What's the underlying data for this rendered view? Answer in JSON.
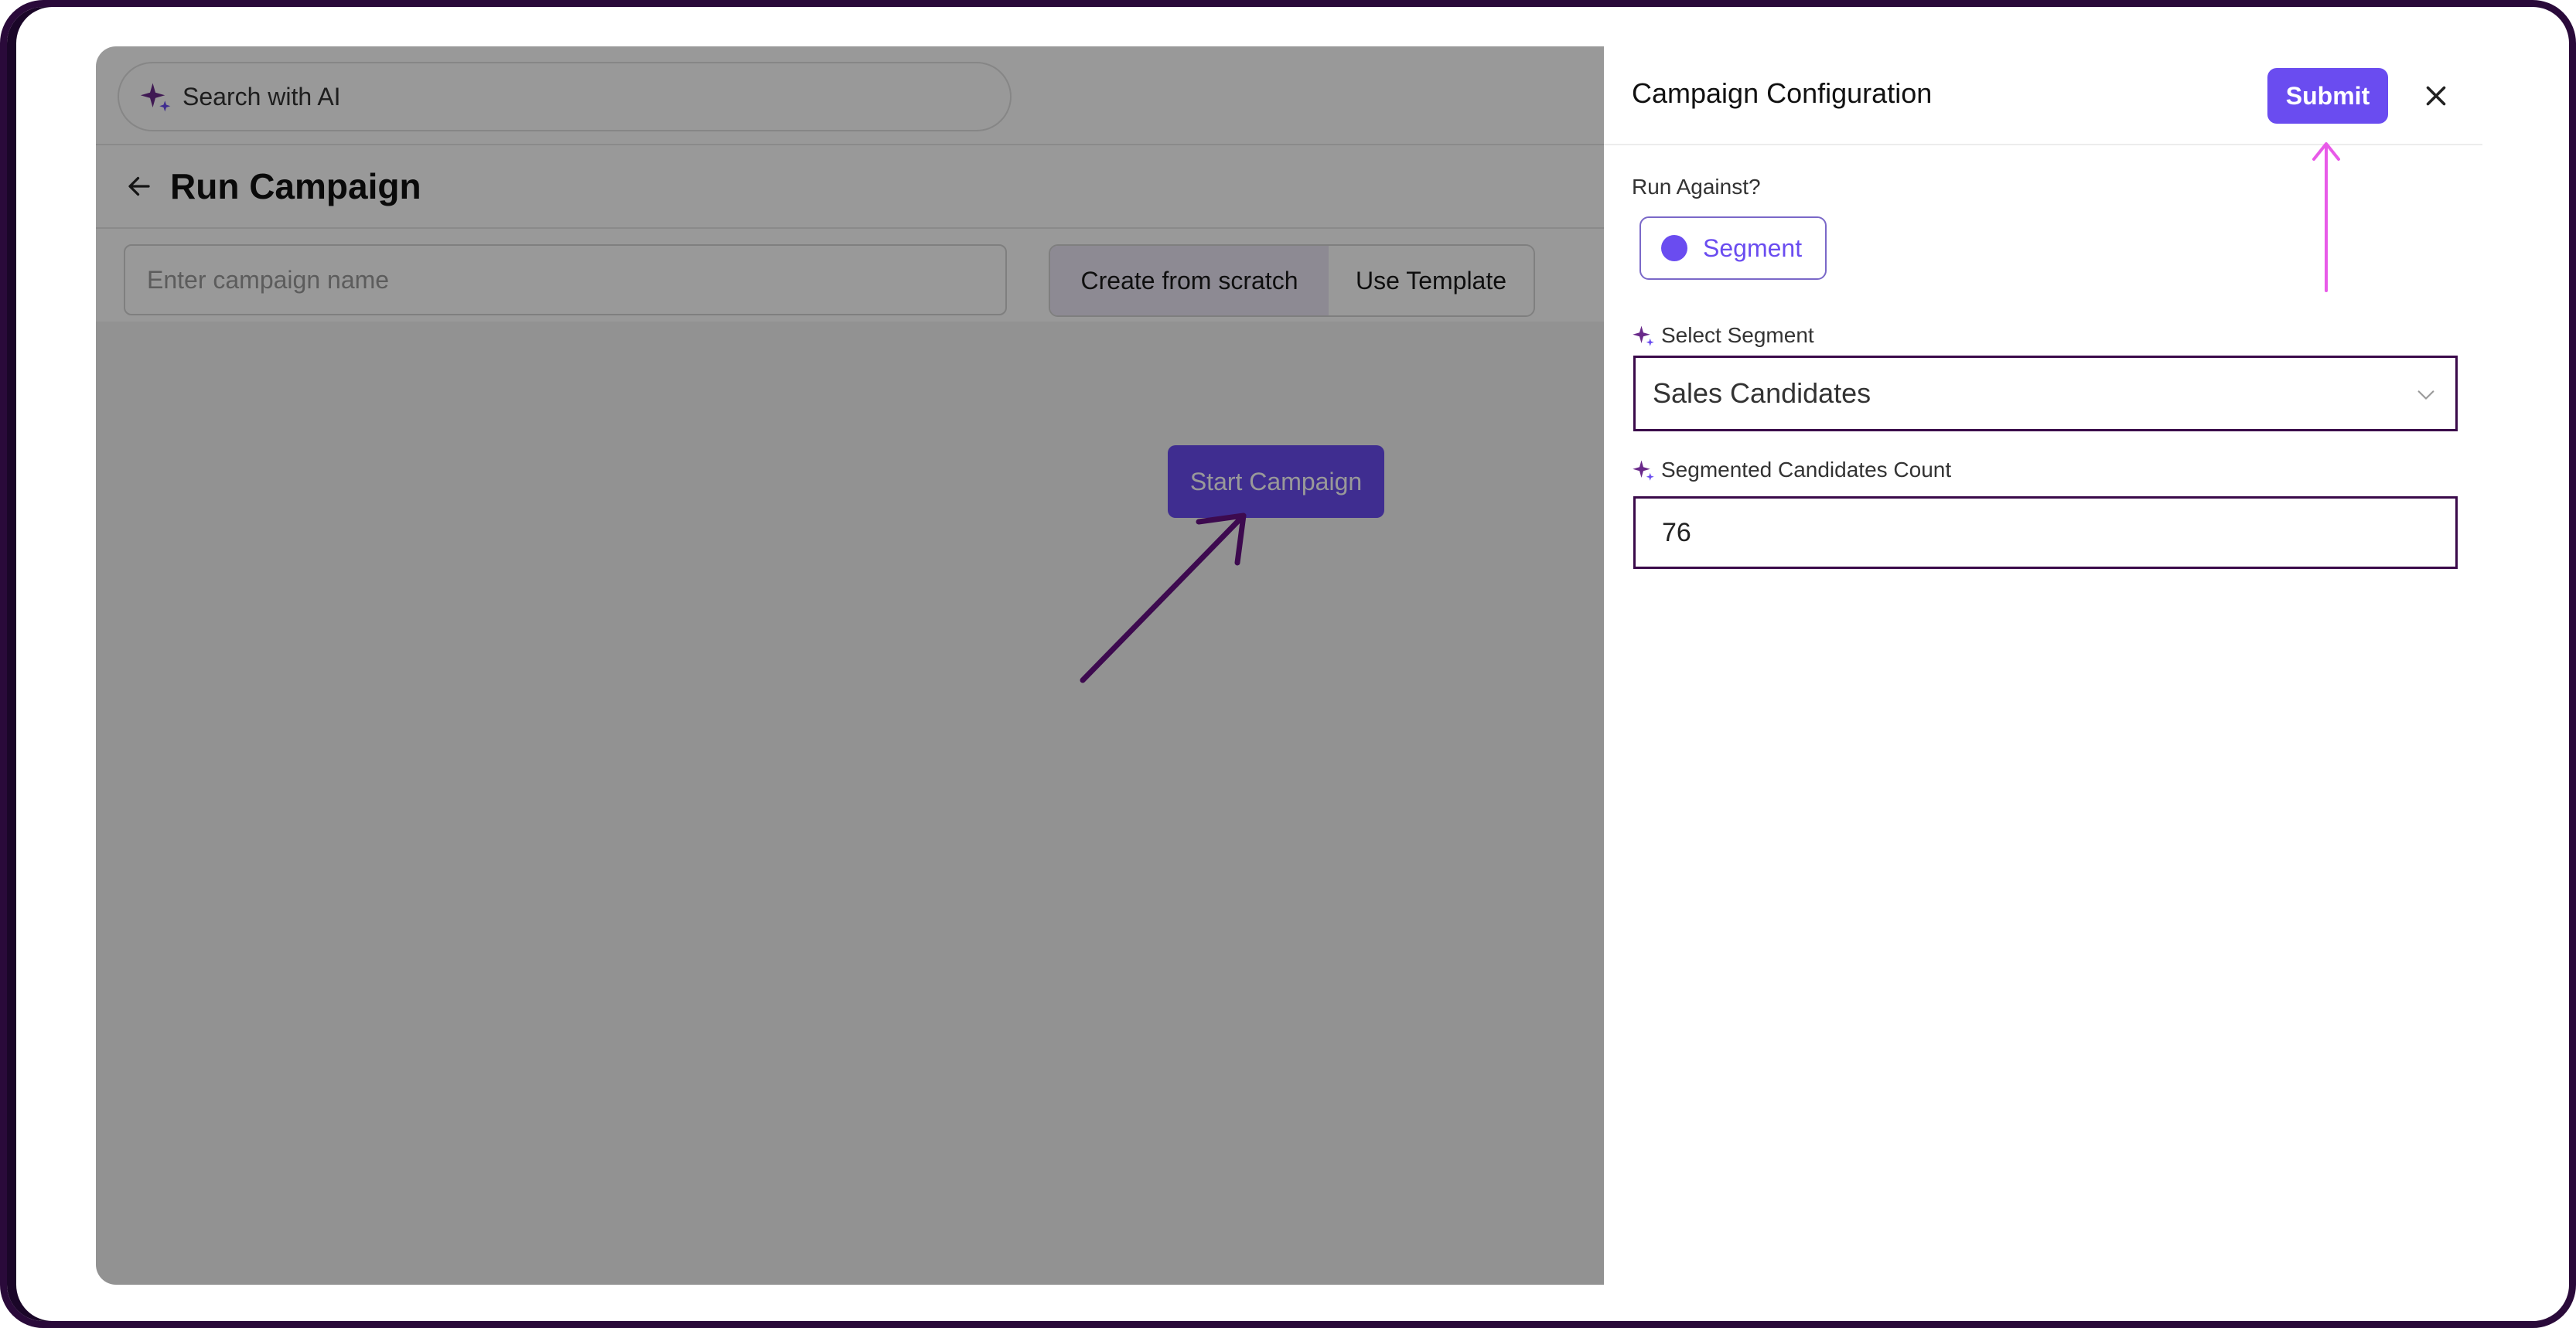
{
  "search": {
    "placeholder": "Search with AI"
  },
  "header": {
    "title": "Run Campaign"
  },
  "form": {
    "name_placeholder": "Enter campaign name",
    "name_value": "",
    "mode_options": [
      "Create from scratch",
      "Use Template"
    ],
    "selected_mode": "Create from scratch"
  },
  "main": {
    "start_button": "Start Campaign"
  },
  "panel": {
    "title": "Campaign Configuration",
    "submit_label": "Submit",
    "run_against_label": "Run Against?",
    "run_against_option": "Segment",
    "select_segment_label": "Select Segment",
    "select_segment_value": "Sales Candidates",
    "count_label": "Segmented Candidates Count",
    "count_value": "76"
  },
  "colors": {
    "accent": "#6a4cf0",
    "highlight_arrow": "#e85ae8",
    "annotation_arrow": "#3d0a4f",
    "frame": "#2a0a3a"
  },
  "icons": [
    "sparkle-icon",
    "back-arrow-icon",
    "close-icon",
    "chevron-down-icon",
    "radio-selected-icon"
  ]
}
